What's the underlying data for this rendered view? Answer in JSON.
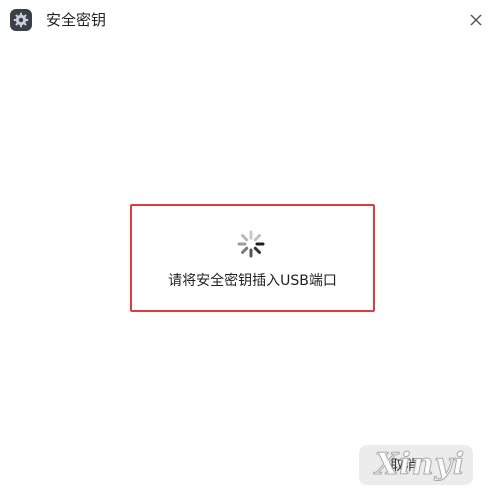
{
  "window": {
    "title": "安全密钥",
    "icons": {
      "app": "settings-gear-icon",
      "close": "close-icon",
      "spinner": "loading-spinner-icon"
    }
  },
  "prompt": {
    "message": "请将安全密钥插入USB端口",
    "highlight_color": "#e23b3b"
  },
  "footer": {
    "cancel_label": "取消",
    "watermark": "Xinyi"
  }
}
